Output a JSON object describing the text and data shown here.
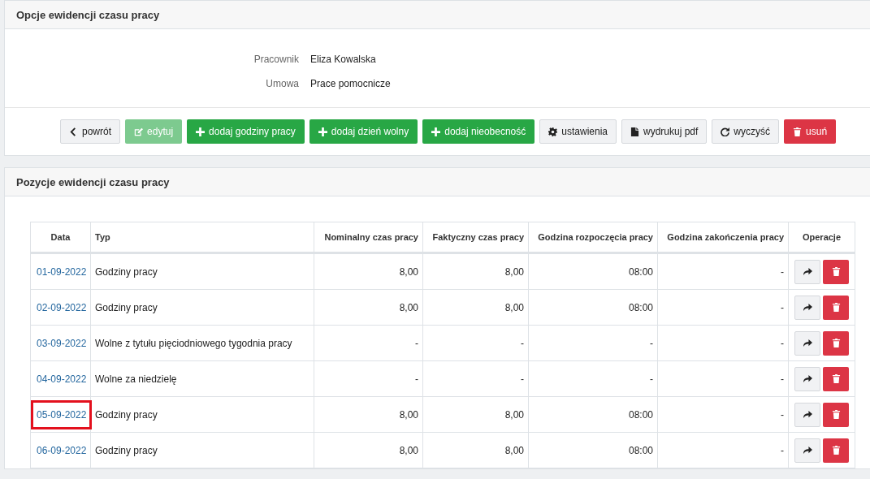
{
  "options_panel": {
    "title": "Opcje ewidencji czasu pracy",
    "fields": [
      {
        "label": "Pracownik",
        "value": "Eliza Kowalska"
      },
      {
        "label": "Umowa",
        "value": "Prace pomocnicze"
      }
    ],
    "buttons": [
      {
        "label": "powrót",
        "kind": "default",
        "disabled": false
      },
      {
        "label": "edytuj",
        "kind": "success",
        "disabled": true
      },
      {
        "label": "dodaj godziny pracy",
        "kind": "success",
        "disabled": false
      },
      {
        "label": "dodaj dzień wolny",
        "kind": "success",
        "disabled": false
      },
      {
        "label": "dodaj nieobecność",
        "kind": "success",
        "disabled": false
      },
      {
        "label": "ustawienia",
        "kind": "default",
        "disabled": false
      },
      {
        "label": "wydrukuj pdf",
        "kind": "default",
        "disabled": false
      },
      {
        "label": "wyczyść",
        "kind": "default",
        "disabled": false
      },
      {
        "label": "usuń",
        "kind": "danger",
        "disabled": false
      }
    ]
  },
  "entries_panel": {
    "title": "Pozycje ewidencji czasu pracy",
    "table": {
      "columns": [
        "Data",
        "Typ",
        "Nominalny czas pracy",
        "Faktyczny czas pracy",
        "Godzina rozpoczęcia pracy",
        "Godzina zakończenia pracy",
        "Operacje"
      ],
      "rows": [
        {
          "date": "01-09-2022",
          "type": "Godziny pracy",
          "nominal": "8,00",
          "actual": "8,00",
          "start": "08:00",
          "end": "-",
          "highlighted": false
        },
        {
          "date": "02-09-2022",
          "type": "Godziny pracy",
          "nominal": "8,00",
          "actual": "8,00",
          "start": "08:00",
          "end": "-",
          "highlighted": false
        },
        {
          "date": "03-09-2022",
          "type": "Wolne z tytułu pięciodniowego tygodnia pracy",
          "nominal": "-",
          "actual": "-",
          "start": "-",
          "end": "-",
          "highlighted": false
        },
        {
          "date": "04-09-2022",
          "type": "Wolne za niedzielę",
          "nominal": "-",
          "actual": "-",
          "start": "-",
          "end": "-",
          "highlighted": false
        },
        {
          "date": "05-09-2022",
          "type": "Godziny pracy",
          "nominal": "8,00",
          "actual": "8,00",
          "start": "08:00",
          "end": "-",
          "highlighted": true
        },
        {
          "date": "06-09-2022",
          "type": "Godziny pracy",
          "nominal": "8,00",
          "actual": "8,00",
          "start": "08:00",
          "end": "-",
          "highlighted": false
        }
      ]
    }
  }
}
